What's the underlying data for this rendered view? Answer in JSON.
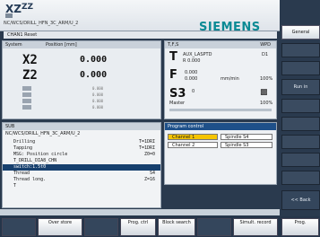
{
  "header": {
    "logo_left": "XZ",
    "logo_right": "ZZ",
    "program_path": "NC/WCS/DRILL_HFN_3C_ARM/U_2",
    "brand": "SIEMENS",
    "channel_state": "CHAN1 Reset"
  },
  "axes_panel": {
    "col_axis": "System",
    "col_pos": "Position [mm]",
    "axes": [
      {
        "name": "X2",
        "value": "0.000"
      },
      {
        "name": "Z2",
        "value": "0.000"
      }
    ],
    "small_rows": [
      "0.000",
      "0.000",
      "0.000",
      "0.000"
    ]
  },
  "tool_panel": {
    "head_left": "T,F,S",
    "head_right": "WPD",
    "t_label": "T",
    "t_name": "AUX_LASPTD",
    "t_value": "D1",
    "t_sub": "R 0.000",
    "f_label": "F",
    "f_val1": "0.000",
    "f_val2": "0.000",
    "f_unit": "mm/min",
    "f_pct": "100%",
    "s_label": "S3",
    "s_val": "0",
    "s_sub": "Master",
    "s_pct": "100%"
  },
  "program_panel": {
    "head": "SUB",
    "path": "NC/WCS/DRILL_HFN_3C_ARM/U_2",
    "lines": [
      {
        "text": "Drilling",
        "right": "T=1DRI"
      },
      {
        "text": "Tapping",
        "right": "T=1DRI"
      },
      {
        "text": "MSG: Position circle",
        "right": "Z0=0"
      },
      {
        "text": "T_DRILL_DIA8_CHN",
        "right": ""
      },
      {
        "text": "switch:1.5t0",
        "right": ""
      },
      {
        "text": "Thread",
        "right": "S4"
      },
      {
        "text": "Thread long.",
        "right": "Z=16"
      },
      {
        "text": "T",
        "right": ""
      }
    ]
  },
  "program_control": {
    "title": "Program control",
    "channels": [
      {
        "label": "Channel 1",
        "spindle": "Spindle S4",
        "active": true
      },
      {
        "label": "Channel 2",
        "spindle": "Spindle S3",
        "active": false
      }
    ]
  },
  "softkeys_right": {
    "general": "General",
    "reset": "Run in",
    "back": "<< Back"
  },
  "softkeys_bottom": {
    "k1": "Over store",
    "k2": "Prog. ctrl",
    "k3": "Block search",
    "k4": "Simult. record",
    "k5": "Prog."
  },
  "colors": {
    "brand": "#0a8a94",
    "selection": "#17406e",
    "highlight": "#f5c400"
  }
}
